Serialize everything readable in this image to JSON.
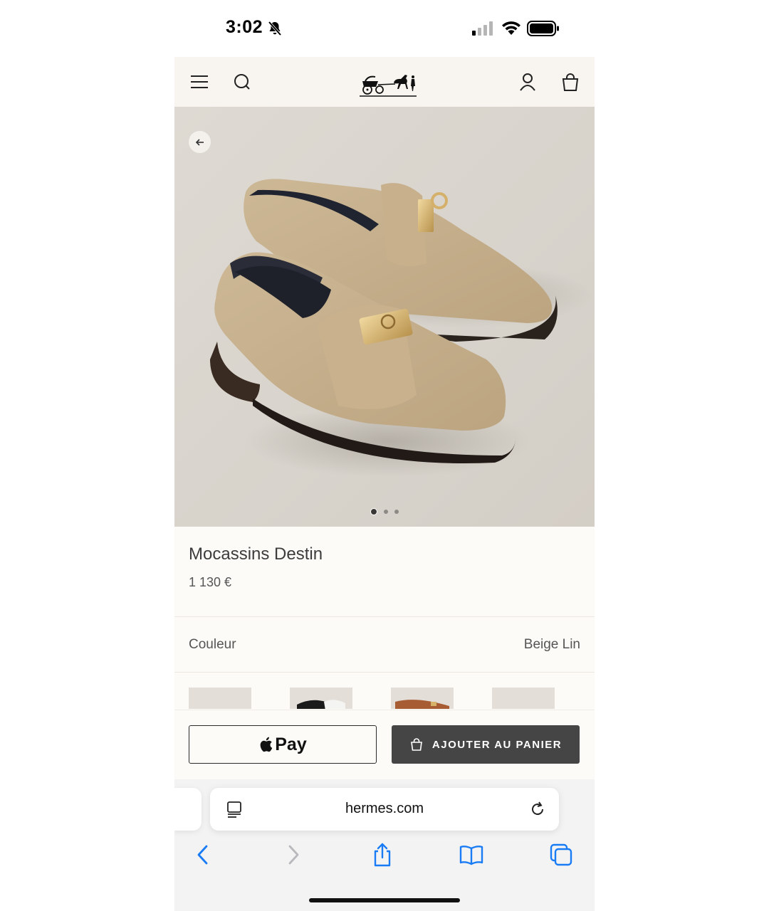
{
  "status_bar": {
    "time": "3:02"
  },
  "header": {
    "icons": [
      "menu-icon",
      "search-icon",
      "hermes-carriage-logo",
      "account-icon",
      "shopping-bag-icon"
    ]
  },
  "product": {
    "name": "Mocassins Destin",
    "price": "1 130 €",
    "color_label": "Couleur",
    "color_value": "Beige Lin",
    "image_count": 3,
    "active_image_index": 0
  },
  "actions": {
    "apple_pay_label": "Pay",
    "add_to_cart_label": "AJOUTER AU PANIER"
  },
  "browser": {
    "url": "hermes.com"
  },
  "colors": {
    "page_bg": "#fdfbf8",
    "header_bg": "#f8f4ef",
    "hero_bg": "#ddd9d2",
    "cart_button": "#454545",
    "safari_blue": "#1a7cf5"
  }
}
